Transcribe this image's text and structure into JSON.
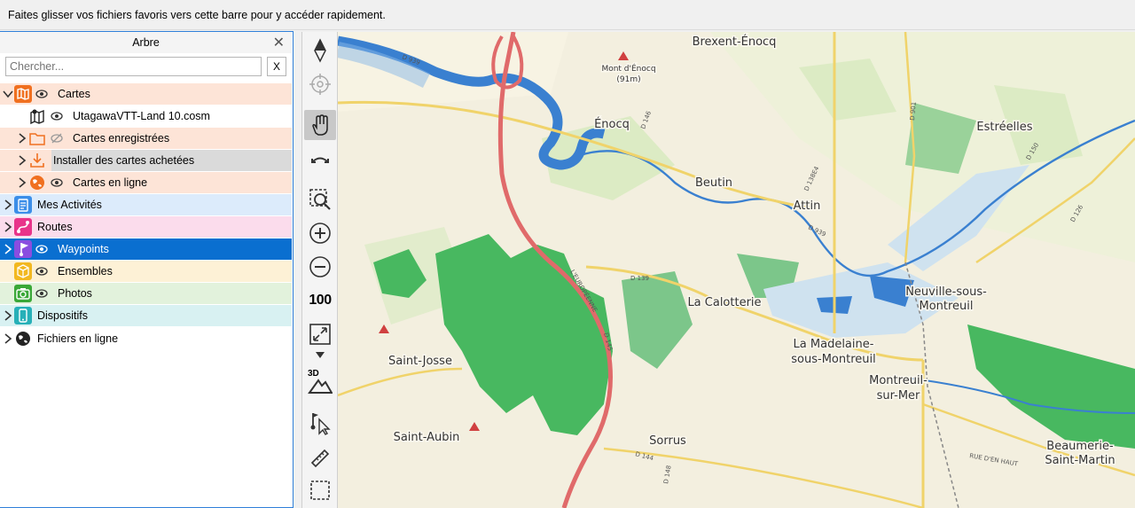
{
  "favorites_bar": {
    "text": "Faites glisser vos fichiers favoris vers cette barre pour y accéder rapidement."
  },
  "panel": {
    "title": "Arbre",
    "close_glyph": "✕",
    "search": {
      "placeholder": "Chercher...",
      "value": "",
      "clear_label": "X"
    },
    "tree": [
      {
        "label": "Cartes",
        "icon": "map-icon",
        "color": "#f07020"
      },
      {
        "label": "UtagawaVTT-Land 10.cosm",
        "icon": "map-file-icon"
      },
      {
        "label": "Cartes enregistrées",
        "icon": "folder-icon"
      },
      {
        "label": "Installer des cartes achetées",
        "icon": "download-icon"
      },
      {
        "label": "Cartes en ligne",
        "icon": "globe-icon"
      },
      {
        "label": "Mes Activités",
        "icon": "clipboard-icon",
        "color": "#3b8ee8"
      },
      {
        "label": "Routes",
        "icon": "route-icon",
        "color": "#e8348a"
      },
      {
        "label": "Waypoints",
        "icon": "flag-icon",
        "color": "#8a4de0"
      },
      {
        "label": "Ensembles",
        "icon": "cube-icon",
        "color": "#f2b820"
      },
      {
        "label": "Photos",
        "icon": "camera-icon",
        "color": "#3aa838"
      },
      {
        "label": "Dispositifs",
        "icon": "phone-icon",
        "color": "#27b0b8"
      },
      {
        "label": "Fichiers en ligne",
        "icon": "globe-icon"
      }
    ]
  },
  "toolbar": {
    "zoom_level_label": "100",
    "dimension_label": "3D"
  },
  "map": {
    "places": [
      {
        "name": "Brexent-Énocq"
      },
      {
        "name": "Mont d'Énocq"
      },
      {
        "name": "(91m)"
      },
      {
        "name": "Énocq"
      },
      {
        "name": "Estréelles"
      },
      {
        "name": "Beutin"
      },
      {
        "name": "Attin"
      },
      {
        "name": "La Calotterie"
      },
      {
        "name": "Neuville-sous-"
      },
      {
        "name": "Montreuil"
      },
      {
        "name": "La Madelaine-"
      },
      {
        "name": "sous-Montreuil"
      },
      {
        "name": "Saint-Josse"
      },
      {
        "name": "Montreuil-"
      },
      {
        "name": "sur-Mer"
      },
      {
        "name": "Saint-Aubin"
      },
      {
        "name": "Sorrus"
      },
      {
        "name": "Beaumerie-"
      },
      {
        "name": "Saint-Martin"
      }
    ],
    "road_labels": [
      "D 939",
      "D 146",
      "D 139",
      "L'EUROPÉENNE",
      "D 145",
      "D 144",
      "D 148",
      "D 150",
      "D 126",
      "D 901",
      "D 138E4",
      "RUE D'EN HAUT",
      "D 939"
    ],
    "colors": {
      "forest": "#48b860",
      "water": "#3a80d0",
      "motorway": "#e06a6a",
      "road": "#f0d36a"
    }
  }
}
